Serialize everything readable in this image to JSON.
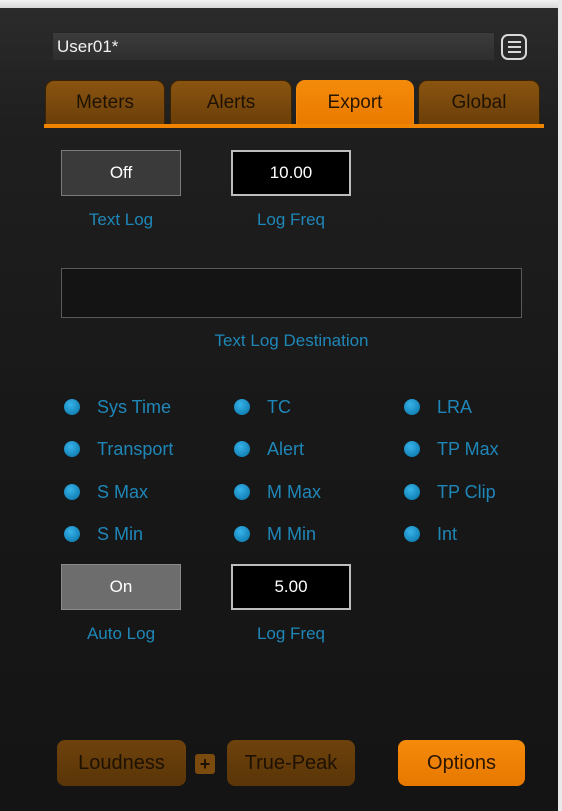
{
  "preset": {
    "name": "User01*",
    "menu_icon": "hamburger-menu-icon"
  },
  "tabs": [
    {
      "label": "Meters",
      "active": false
    },
    {
      "label": "Alerts",
      "active": false
    },
    {
      "label": "Export",
      "active": true
    },
    {
      "label": "Global",
      "active": false
    }
  ],
  "text_log": {
    "toggle_value": "Off",
    "toggle_label": "Text Log",
    "freq_value": "10.00",
    "freq_label": "Log Freq"
  },
  "destination": {
    "value": "",
    "label": "Text Log Destination"
  },
  "options": {
    "col1": [
      "Sys Time",
      "Transport",
      "S Max",
      "S Min"
    ],
    "col2": [
      "TC",
      "Alert",
      "M Max",
      "M Min"
    ],
    "col3": [
      "LRA",
      "TP Max",
      "TP Clip",
      "Int"
    ]
  },
  "auto_log": {
    "toggle_value": "On",
    "toggle_label": "Auto Log",
    "freq_value": "5.00",
    "freq_label": "Log Freq"
  },
  "bottom": {
    "loudness": "Loudness",
    "plus": "+",
    "true_peak": "True-Peak",
    "options": "Options"
  },
  "colors": {
    "accent": "#f08300",
    "accent_dim": "#6e420c",
    "label_blue": "#1f87b8",
    "dot_blue": "#1483b8"
  }
}
